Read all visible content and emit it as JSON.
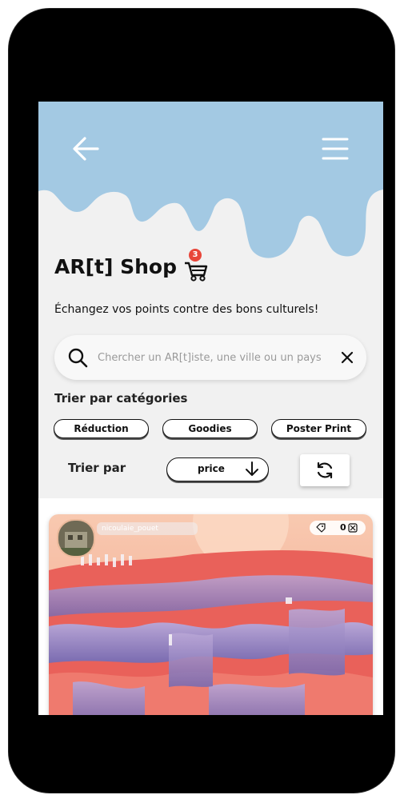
{
  "header": {
    "title": "AR[t] Shop",
    "cart_count": "3"
  },
  "subtitle": "Échangez vos points contre des bons culturels!",
  "search": {
    "placeholder": "Chercher un AR[t]iste, une ville ou un pays"
  },
  "categories": {
    "label": "Trier par catégories",
    "items": [
      "Réduction",
      "Goodies",
      "Poster Print"
    ]
  },
  "sort": {
    "label": "Trier par",
    "value": "price"
  },
  "product_card": {
    "artist": "nicoulaie_pouet",
    "price": "0"
  },
  "colors": {
    "header_blue": "#a3c9e3",
    "background": "#f1f1f1",
    "badge_red": "#e8463a"
  },
  "icons": [
    "back-arrow-icon",
    "hamburger-menu-icon",
    "cart-icon",
    "search-icon",
    "close-icon",
    "arrow-down-icon",
    "refresh-icon",
    "tag-icon",
    "coin-icon"
  ]
}
